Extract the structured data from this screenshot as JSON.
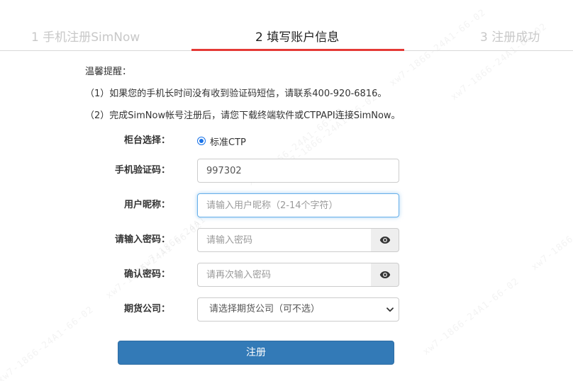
{
  "steps": [
    {
      "label": "1 手机注册SimNow"
    },
    {
      "label": "2 填写账户信息"
    },
    {
      "label": "3 注册成功"
    }
  ],
  "notice": {
    "title": "温馨提醒：",
    "line1": "（1）如果您的手机长时间没有收到验证码短信，请联系400-920-6816。",
    "line2": "（2）完成SimNow帐号注册后，请您下载终端软件或CTPAPI连接SimNow。"
  },
  "form": {
    "counter": {
      "label": "柜台选择：",
      "option": "标准CTP"
    },
    "sms_code": {
      "label": "手机验证码：",
      "value": "997302"
    },
    "nickname": {
      "label": "用户昵称：",
      "placeholder": "请输入用户昵称（2-14个字符）"
    },
    "password": {
      "label": "请输入密码：",
      "placeholder": "请输入密码"
    },
    "confirm": {
      "label": "确认密码：",
      "placeholder": "请再次输入密码"
    },
    "broker": {
      "label": "期货公司：",
      "selected": "请选择期货公司（可不选）"
    },
    "submit_label": "注册"
  },
  "colors": {
    "accent_red": "#e53935",
    "primary_blue": "#337ab7",
    "focus_blue": "#66afe9"
  },
  "icons": {
    "password_toggle": "eye-icon",
    "confirm_toggle": "eye-icon",
    "broker_dropdown": "chevron-down-icon"
  }
}
